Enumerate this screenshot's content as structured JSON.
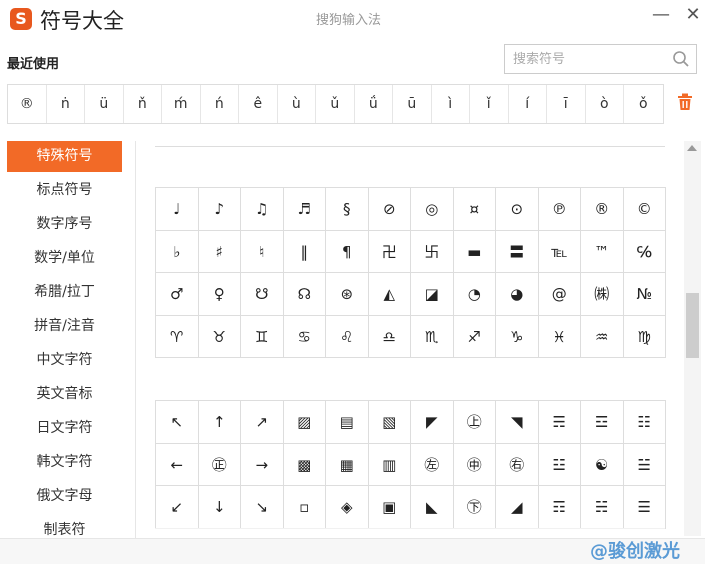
{
  "window": {
    "app_title": "符号大全",
    "window_subtitle": "搜狗输入法",
    "logo_letter": "S",
    "minimize_label": "—",
    "close_label": "✕"
  },
  "recent": {
    "title": "最近使用",
    "symbols": [
      "®",
      "ṅ",
      "ü",
      "ň",
      "ḿ",
      "ń",
      "ê",
      "ù",
      "ǔ",
      "ǘ",
      "ū",
      "ì",
      "ǐ",
      "í",
      "ī",
      "ò",
      "ǒ"
    ]
  },
  "search": {
    "placeholder": "搜索符号",
    "value": ""
  },
  "sidebar": {
    "items": [
      {
        "label": "特殊符号",
        "active": true
      },
      {
        "label": "标点符号",
        "active": false
      },
      {
        "label": "数字序号",
        "active": false
      },
      {
        "label": "数学/单位",
        "active": false
      },
      {
        "label": "希腊/拉丁",
        "active": false
      },
      {
        "label": "拼音/注音",
        "active": false
      },
      {
        "label": "中文字符",
        "active": false
      },
      {
        "label": "英文音标",
        "active": false
      },
      {
        "label": "日文字符",
        "active": false
      },
      {
        "label": "韩文字符",
        "active": false
      },
      {
        "label": "俄文字母",
        "active": false
      },
      {
        "label": "制表符",
        "active": false
      }
    ]
  },
  "grid1": {
    "rows": [
      [
        "♩",
        "♪",
        "♫",
        "♬",
        "§",
        "⊘",
        "◎",
        "¤",
        "⊙",
        "℗",
        "®",
        "©"
      ],
      [
        "♭",
        "♯",
        "♮",
        "‖",
        "¶",
        "卍",
        "卐",
        "▬",
        "〓",
        "℡",
        "™",
        "℅"
      ],
      [
        "♂",
        "♀",
        "☋",
        "☊",
        "⊛",
        "◭",
        "◪",
        "◔",
        "◕",
        "@",
        "㈱",
        "№"
      ],
      [
        "♈",
        "♉",
        "♊",
        "♋",
        "♌",
        "♎",
        "♏",
        "♐",
        "♑",
        "♓",
        "♒",
        "♍"
      ]
    ]
  },
  "grid2": {
    "rows": [
      [
        "↖",
        "↑",
        "↗",
        "▨",
        "▤",
        "▧",
        "◤",
        "㊤",
        "◥",
        "☴",
        "☲",
        "☷"
      ],
      [
        "←",
        "㊣",
        "→",
        "▩",
        "▦",
        "▥",
        "㊧",
        "㊥",
        "㊨",
        "☳",
        "☯",
        "☱"
      ],
      [
        "↙",
        "↓",
        "↘",
        "▫",
        "◈",
        "▣",
        "◣",
        "㊦",
        "◢",
        "☶",
        "☵",
        "☰"
      ]
    ]
  },
  "watermark": "@骏创激光",
  "colors": {
    "accent": "#f26a27",
    "logo": "#e8581e",
    "watermark": "#5b9bd5"
  }
}
